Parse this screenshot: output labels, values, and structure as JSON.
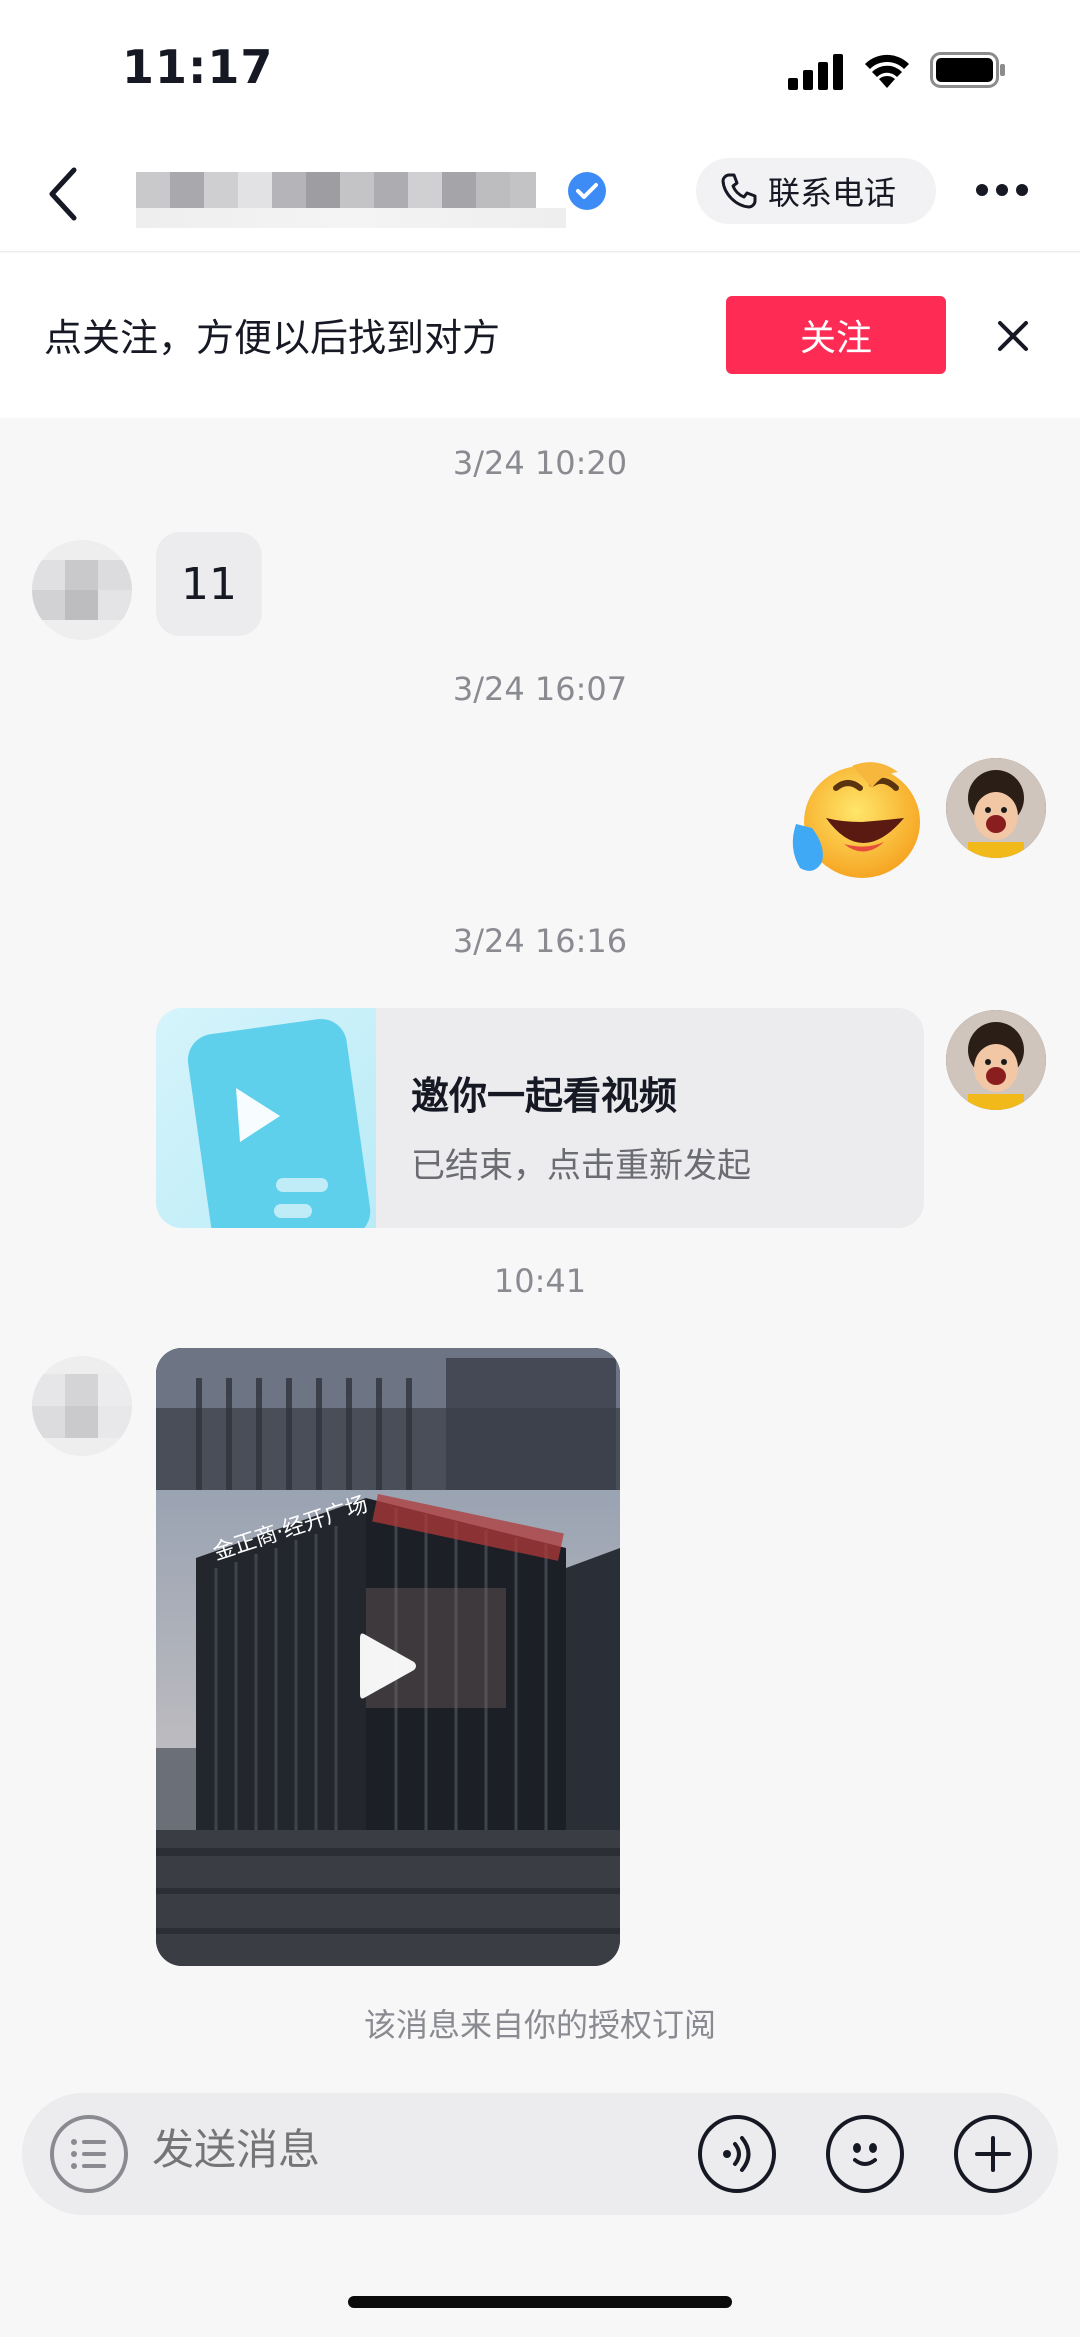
{
  "status_bar": {
    "time": "11:17"
  },
  "header": {
    "contact_name": "",
    "verified": true,
    "phone_button_label": "联系电话"
  },
  "banner": {
    "text": "点关注，方便以后找到对方",
    "follow_label": "关注"
  },
  "messages": [
    {
      "timestamp": "3/24 10:20",
      "from": "other",
      "type": "text",
      "text": "11"
    },
    {
      "timestamp": "3/24 16:07",
      "from": "me",
      "type": "emoji",
      "emoji": "laughing-crying-emoji"
    },
    {
      "timestamp": "3/24 16:16",
      "from": "me",
      "type": "watch-together",
      "title": "邀你一起看视频",
      "subtitle": "已结束，点击重新发起"
    },
    {
      "timestamp": "10:41",
      "from": "other",
      "type": "video",
      "overlay_text": "金正商·经开广场"
    }
  ],
  "subscribe_note": "该消息来自你的授权订阅",
  "input": {
    "placeholder": "发送消息"
  },
  "colors": {
    "accent": "#fe2c55",
    "verified_blue": "#3d8cf5"
  }
}
